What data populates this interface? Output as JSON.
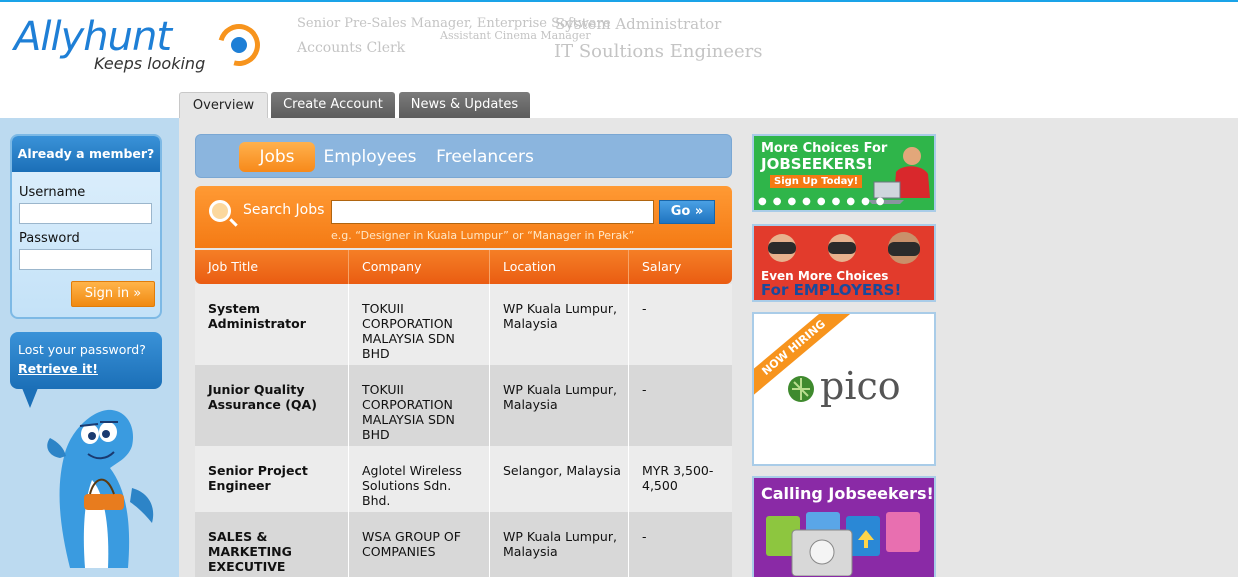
{
  "header": {
    "logo_text": "Allyhunt",
    "tagline": "Keeps looking",
    "tag_cloud": [
      "Senior Pre-Sales Manager, Enterprise Software",
      "System Administrator",
      "Assistant Cinema Manager",
      "Accounts Clerk",
      "IT Soultions Engineers"
    ]
  },
  "tabs": [
    "Overview",
    "Create Account",
    "News & Updates"
  ],
  "login": {
    "heading": "Already a member?",
    "username_label": "Username",
    "password_label": "Password",
    "signin_label": "Sign in »",
    "lost_text": "Lost your password?",
    "retrieve_text": "Retrieve it!"
  },
  "segments": [
    "Jobs",
    "Employees",
    "Freelancers"
  ],
  "search": {
    "label": "Search Jobs",
    "go_label": "Go »",
    "hint": "e.g. “Designer in Kuala Lumpur” or “Manager in Perak”"
  },
  "table": {
    "headers": [
      "Job Title",
      "Company",
      "Location",
      "Salary"
    ],
    "rows": [
      {
        "title": "System Administrator",
        "company": "TOKUII CORPORATION MALAYSIA SDN BHD",
        "location": "WP Kuala Lumpur, Malaysia",
        "salary": "-"
      },
      {
        "title": "Junior Quality Assurance (QA)",
        "company": "TOKUII CORPORATION MALAYSIA SDN BHD",
        "location": "WP Kuala Lumpur, Malaysia",
        "salary": "-"
      },
      {
        "title": "Senior Project Engineer",
        "company": "Aglotel Wireless Solutions Sdn. Bhd.",
        "location": "Selangor, Malaysia",
        "salary": "MYR 3,500-4,500"
      },
      {
        "title": "SALES & MARKETING EXECUTIVE",
        "company": "WSA GROUP OF COMPANIES",
        "location": "WP Kuala Lumpur, Malaysia",
        "salary": "-"
      }
    ]
  },
  "ads": {
    "ad1_line1": "More Choices For",
    "ad1_line2": "JOBSEEKERS!",
    "ad1_button": "Sign Up Today!",
    "ad2_line1": "Even More Choices",
    "ad2_line2_prefix": "For",
    "ad2_line2_emph": "EMPLOYERS!",
    "ad3_ribbon": "NOW HIRING",
    "ad3_brand": "pico",
    "ad4_title": "Calling Jobseekers!"
  },
  "colors": {
    "brand_blue": "#1e7fd6",
    "brand_orange": "#f7941d",
    "table_header": "#ea5c12",
    "row_light": "#ececec",
    "row_dark": "#d8d8d8"
  }
}
